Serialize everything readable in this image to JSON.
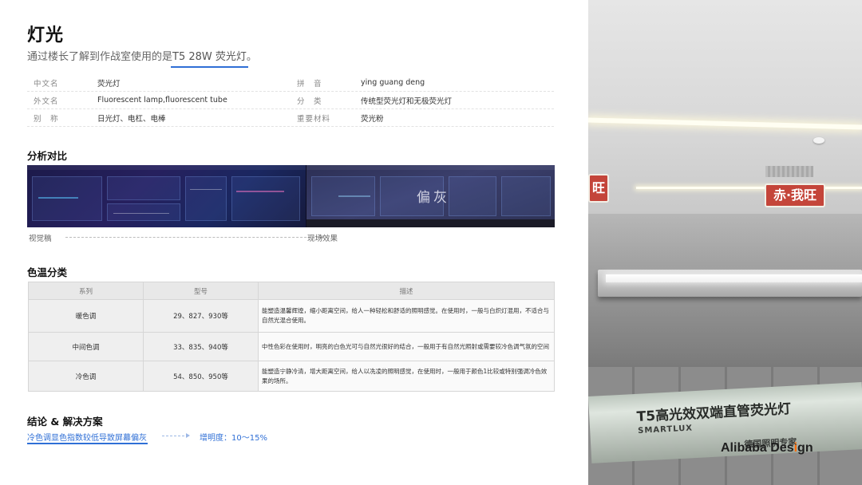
{
  "header": {
    "title": "灯光",
    "subtitle_prefix": "通过楼长了解到作战室使用的是",
    "subtitle_highlight": "T5 28W 荧光灯",
    "subtitle_suffix": "。"
  },
  "info": [
    {
      "k1": "中文名",
      "v1": "荧光灯",
      "k2": "拼　音",
      "v2": "ying guang deng"
    },
    {
      "k1": "外文名",
      "v1": "Fluorescent lamp,fluorescent tube",
      "k2": "分　类",
      "v2": "传统型荧光灯和无极荧光灯"
    },
    {
      "k1": "别　称",
      "v1": "日光灯、电杠、电棒",
      "k2": "重要材料",
      "v2": "荧光粉"
    }
  ],
  "analysis": {
    "title": "分析对比",
    "left_label": "视觉稿",
    "right_label": "现场效果",
    "overlay": "偏灰"
  },
  "color_temp": {
    "title": "色温分类",
    "headers": [
      "系列",
      "型号",
      "描述"
    ],
    "rows": [
      {
        "series": "暖色调",
        "model": "29、827、930等",
        "desc": "能塑造温馨辉煌，缩小距离空间，给人一种轻松和舒适的照明感觉。在使用时，一般与白炽灯混用，不适合与自然光混合使用。"
      },
      {
        "series": "中间色调",
        "model": "33、835、940等",
        "desc": "中性色彩在使用时，明亮的白色光可与自然光很好的结合，一般用于有自然光照射或需要较冷色调气氛的空间"
      },
      {
        "series": "冷色调",
        "model": "54、850、950等",
        "desc": "能塑造宁静冷清，增大距离空间，给人以冼凌的照明感觉，在使用时，一般用于颜色1比较或特别强调冷色效果的场所。"
      }
    ]
  },
  "conclusion": {
    "title": "结论 & 解决方案",
    "text": "冷色调显色指数较低导致屏幕偏灰",
    "result": "增明度：10～15%"
  },
  "photos": {
    "sign_a": "旺",
    "sign_b": "赤·我旺",
    "tube_text": "T5高光效双端直管荧光灯",
    "tube_brand": "SMARTLUX",
    "tube_sub": "德国照明专家"
  },
  "logo": {
    "text_a": "Alibaba Des",
    "text_dot": "i",
    "text_b": "gn",
    "accent": "#ff6a00"
  },
  "colors": {
    "accent": "#2f6fd6"
  }
}
